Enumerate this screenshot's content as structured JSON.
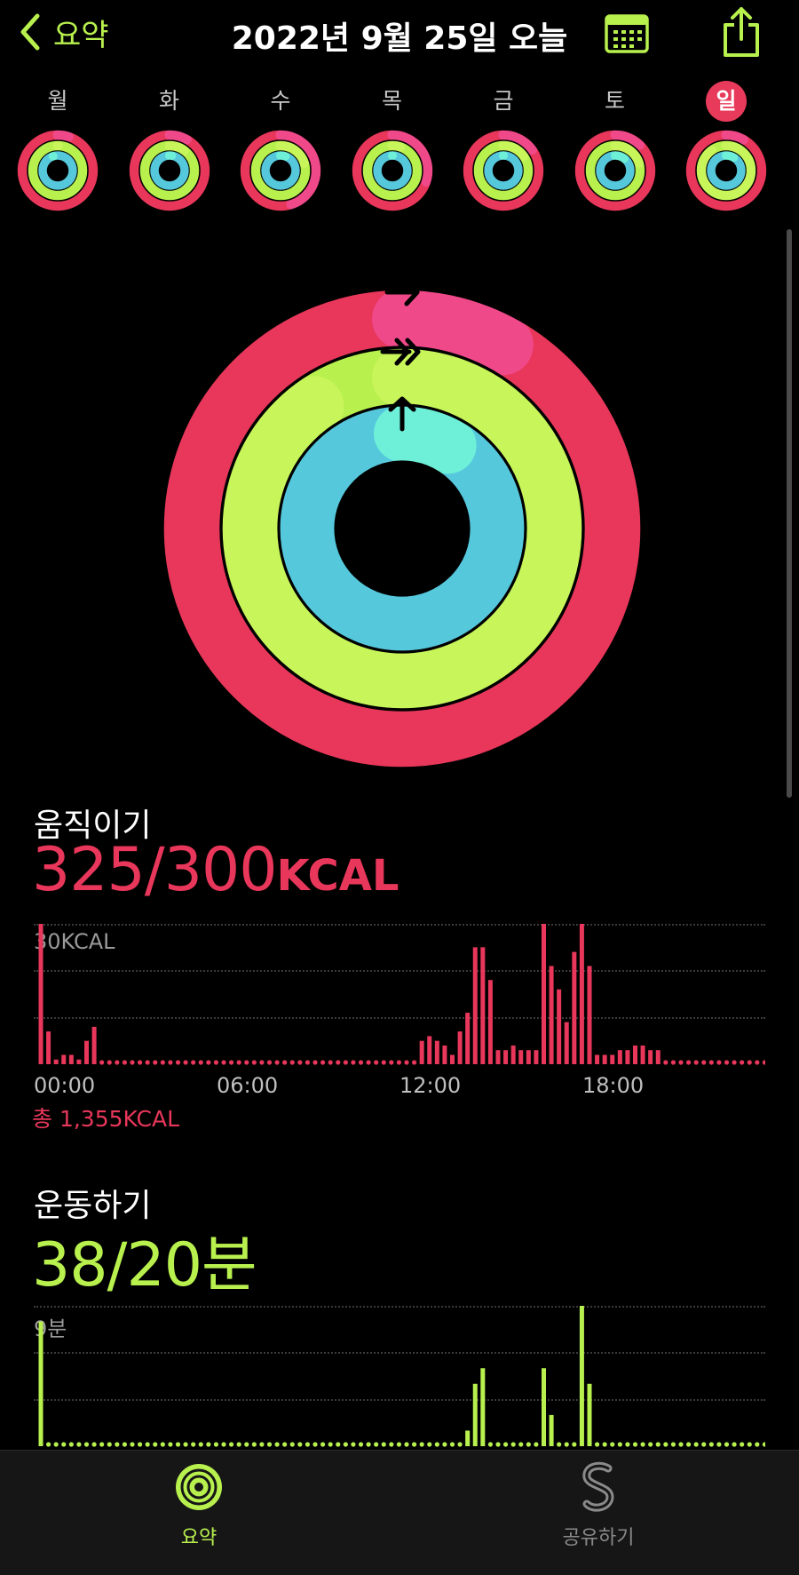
{
  "header": {
    "back_label": "요약",
    "title": "2022년 9월 25일 오늘",
    "back_icon": "chevron-left-icon",
    "calendar_icon": "calendar-icon",
    "share_icon": "share-icon"
  },
  "week": [
    {
      "label": "월",
      "move": 1.05,
      "exercise": 1.0,
      "stand": 0.95,
      "today": false
    },
    {
      "label": "화",
      "move": 1.08,
      "exercise": 1.1,
      "stand": 1.02,
      "today": false
    },
    {
      "label": "수",
      "move": 1.45,
      "exercise": 1.2,
      "stand": 1.05,
      "today": false
    },
    {
      "label": "목",
      "move": 1.3,
      "exercise": 1.05,
      "stand": 1.0,
      "today": false
    },
    {
      "label": "금",
      "move": 1.15,
      "exercise": 1.15,
      "stand": 1.0,
      "today": false
    },
    {
      "label": "토",
      "move": 1.12,
      "exercise": 1.2,
      "stand": 1.1,
      "today": false
    },
    {
      "label": "일",
      "move": 1.08,
      "exercise": 1.9,
      "stand": 1.08,
      "today": true
    }
  ],
  "rings": {
    "move": 1.08,
    "exercise": 1.9,
    "stand": 1.08
  },
  "colors": {
    "move": "#e8375a",
    "move_end": "#f0498a",
    "exercise": "#b8f04e",
    "exercise_end": "#c8f55a",
    "stand": "#56c8dc",
    "stand_end": "#6ef0d8",
    "accent": "#b8f04e"
  },
  "move_section": {
    "title": "움직이기",
    "value": "325/300",
    "unit": "KCAL",
    "chart_top_label": "30KCAL",
    "ticks": [
      "00:00",
      "06:00",
      "12:00",
      "18:00"
    ],
    "total": "총 1,355KCAL"
  },
  "exercise_section": {
    "title": "운동하기",
    "value": "38/20분",
    "chart_top_label": "9분"
  },
  "chart_data": [
    {
      "type": "bar",
      "title": "움직이기",
      "ymax_label": "30KCAL",
      "ylim": [
        0,
        30
      ],
      "x_unit": "hour of day",
      "x_ticks": [
        "00:00",
        "06:00",
        "12:00",
        "18:00"
      ],
      "intervals_per_hour": 4,
      "values": [
        30,
        7,
        1,
        2,
        2,
        1,
        5,
        8,
        0,
        0,
        0,
        0,
        0,
        0,
        0,
        0,
        0,
        0,
        0,
        0,
        0,
        0,
        0,
        0,
        0,
        0,
        0,
        0,
        0,
        0,
        0,
        0,
        0,
        0,
        0,
        0,
        0,
        0,
        0,
        0,
        0,
        0,
        0,
        0,
        0,
        0,
        0,
        0,
        0,
        0,
        5,
        6,
        5,
        4,
        2,
        7,
        11,
        25,
        25,
        18,
        3,
        3,
        4,
        3,
        3,
        3,
        31,
        21,
        16,
        9,
        24,
        31,
        21,
        2,
        2,
        2,
        3,
        3,
        4,
        4,
        3,
        3,
        0,
        0,
        0,
        0,
        0,
        0,
        0,
        0,
        0,
        0,
        0,
        0,
        0,
        0
      ]
    },
    {
      "type": "bar",
      "title": "운동하기",
      "ymax_label": "9분",
      "ylim": [
        0,
        9
      ],
      "x_unit": "hour of day",
      "intervals_per_hour": 4,
      "values": [
        8,
        0,
        0,
        0,
        0,
        0,
        0,
        0,
        0,
        0,
        0,
        0,
        0,
        0,
        0,
        0,
        0,
        0,
        0,
        0,
        0,
        0,
        0,
        0,
        0,
        0,
        0,
        0,
        0,
        0,
        0,
        0,
        0,
        0,
        0,
        0,
        0,
        0,
        0,
        0,
        0,
        0,
        0,
        0,
        0,
        0,
        0,
        0,
        0,
        0,
        0,
        0,
        0,
        0,
        0,
        0,
        1,
        4,
        5,
        0,
        0,
        0,
        0,
        0,
        0,
        0,
        5,
        2,
        0,
        0,
        0,
        9,
        4,
        0,
        0,
        0,
        0,
        0,
        0,
        0,
        0,
        0,
        0,
        0,
        0,
        0,
        0,
        0,
        0,
        0,
        0,
        0,
        0,
        0,
        0,
        0
      ]
    }
  ],
  "tabbar": [
    {
      "label": "요약",
      "icon": "activity-rings-icon",
      "active": true
    },
    {
      "label": "공유하기",
      "icon": "sharing-icon",
      "active": false
    }
  ]
}
